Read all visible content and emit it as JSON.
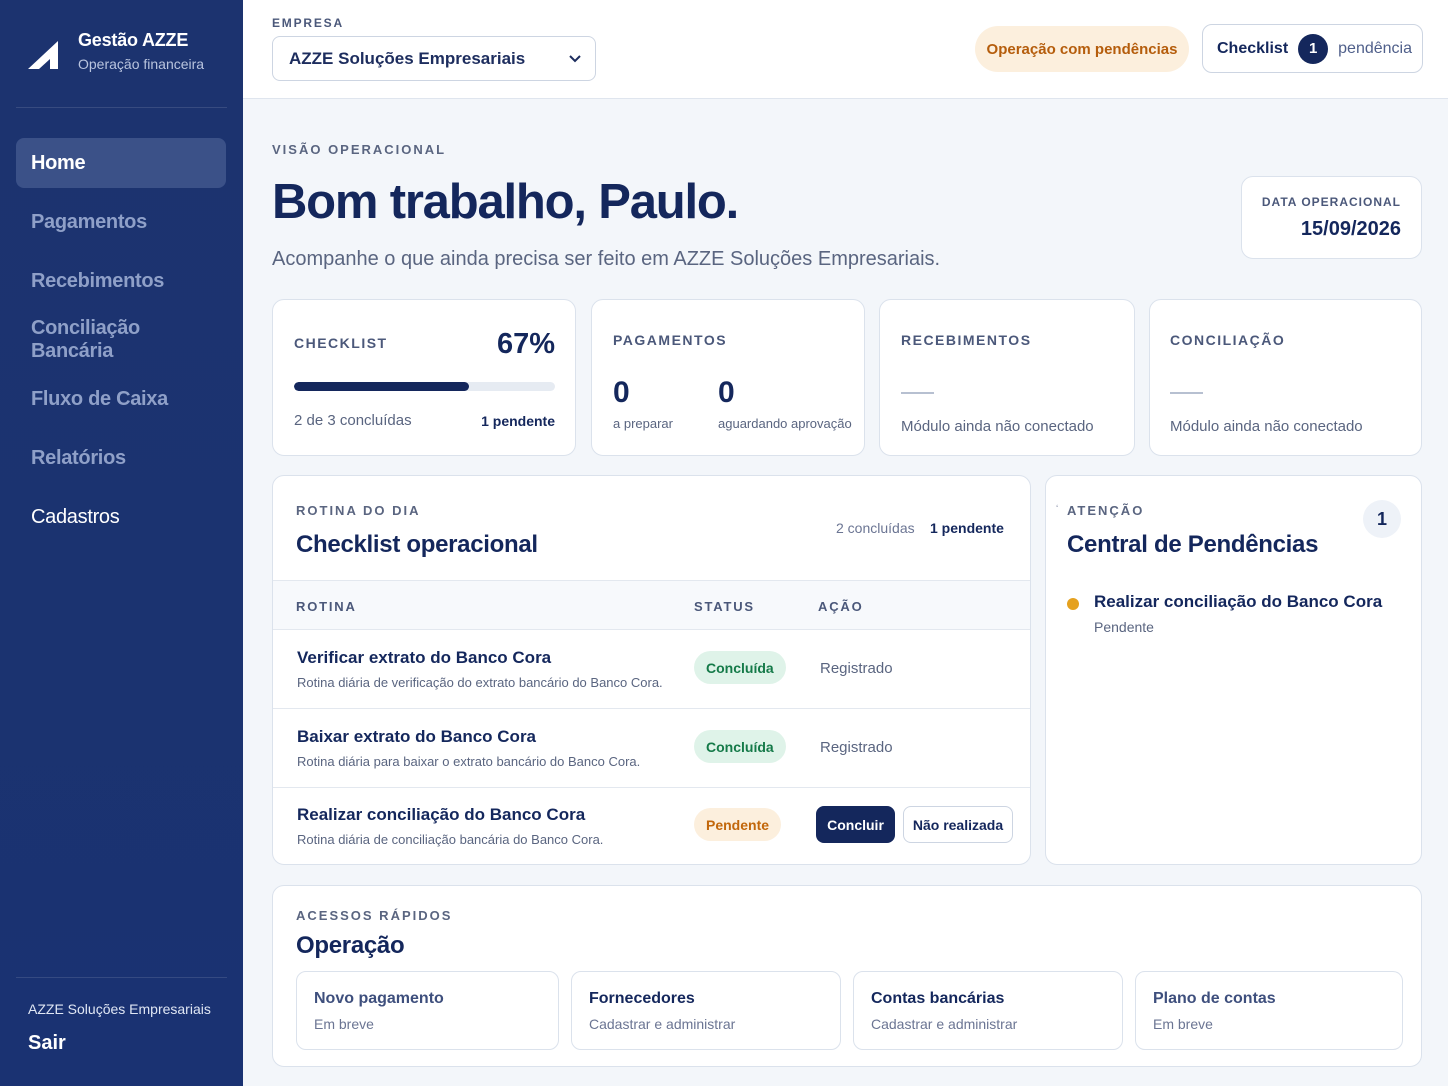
{
  "sidebar": {
    "app_title": "Gestão AZZE",
    "app_subtitle": "Operação financeira",
    "items": [
      {
        "label": "Home",
        "active": true
      },
      {
        "label": "Pagamentos"
      },
      {
        "label": "Recebimentos"
      },
      {
        "label": "Conciliação Bancária"
      },
      {
        "label": "Fluxo de Caixa"
      },
      {
        "label": "Relatórios"
      },
      {
        "label": "Cadastros"
      }
    ],
    "company": "AZZE Soluções Empresariais",
    "logout": "Sair"
  },
  "header": {
    "company_label": "EMPRESA",
    "company_selected": "AZZE Soluções Empresariais",
    "status_badge": "Operação com pendências",
    "checklist_label": "Checklist",
    "checklist_count": "1",
    "checklist_suffix": "pendência"
  },
  "hero": {
    "eyebrow": "VISÃO OPERACIONAL",
    "title": "Bom trabalho, Paulo.",
    "subtitle": "Acompanhe o que ainda precisa ser feito em AZZE Soluções Empresariais.",
    "date_label": "DATA OPERACIONAL",
    "date_value": "15/09/2026"
  },
  "kpis": {
    "checklist": {
      "title": "CHECKLIST",
      "percent": "67%",
      "progress": 0.67,
      "done_text": "2 de 3 concluídas",
      "pending_text": "1 pendente"
    },
    "pagamentos": {
      "title": "PAGAMENTOS",
      "prep_value": "0",
      "prep_label": "a preparar",
      "approval_value": "0",
      "approval_label": "aguardando aprovação"
    },
    "recebimentos": {
      "title": "RECEBIMENTOS",
      "status": "Módulo ainda não conectado"
    },
    "conciliacao": {
      "title": "CONCILIAÇÃO",
      "status": "Módulo ainda não conectado"
    }
  },
  "checklist": {
    "eyebrow": "ROTINA DO DIA",
    "title": "Checklist operacional",
    "done_summary": "2 concluídas",
    "pending_summary": "1 pendente",
    "columns": [
      "ROTINA",
      "STATUS",
      "AÇÃO"
    ],
    "rows": [
      {
        "title": "Verificar extrato do Banco Cora",
        "desc": "Rotina diária de verificação do extrato bancário do Banco Cora.",
        "status": "Concluída",
        "action": "Registrado"
      },
      {
        "title": "Baixar extrato do Banco Cora",
        "desc": "Rotina diária para baixar o extrato bancário do Banco Cora.",
        "status": "Concluída",
        "action": "Registrado"
      },
      {
        "title": "Realizar conciliação do Banco Cora",
        "desc": "Rotina diária de conciliação bancária do Banco Cora.",
        "status": "Pendente",
        "btn_primary": "Concluir",
        "btn_secondary": "Não realizada"
      }
    ]
  },
  "pendencias": {
    "eyebrow": "ATENÇÃO",
    "title": "Central de Pendências",
    "count": "1",
    "items": [
      {
        "title": "Realizar conciliação do Banco Cora",
        "status": "Pendente"
      }
    ]
  },
  "quick": {
    "eyebrow": "ACESSOS RÁPIDOS",
    "title": "Operação",
    "items": [
      {
        "title": "Novo pagamento",
        "sub": "Em breve"
      },
      {
        "title": "Fornecedores",
        "sub": "Cadastrar e administrar"
      },
      {
        "title": "Contas bancárias",
        "sub": "Cadastrar e administrar"
      },
      {
        "title": "Plano de contas",
        "sub": "Em breve"
      }
    ]
  },
  "colors": {
    "navy": "#14275c",
    "sidebar": "#1b3370",
    "success": "#157a49",
    "warning": "#c2670b",
    "warning_dot": "#e5a11f"
  }
}
